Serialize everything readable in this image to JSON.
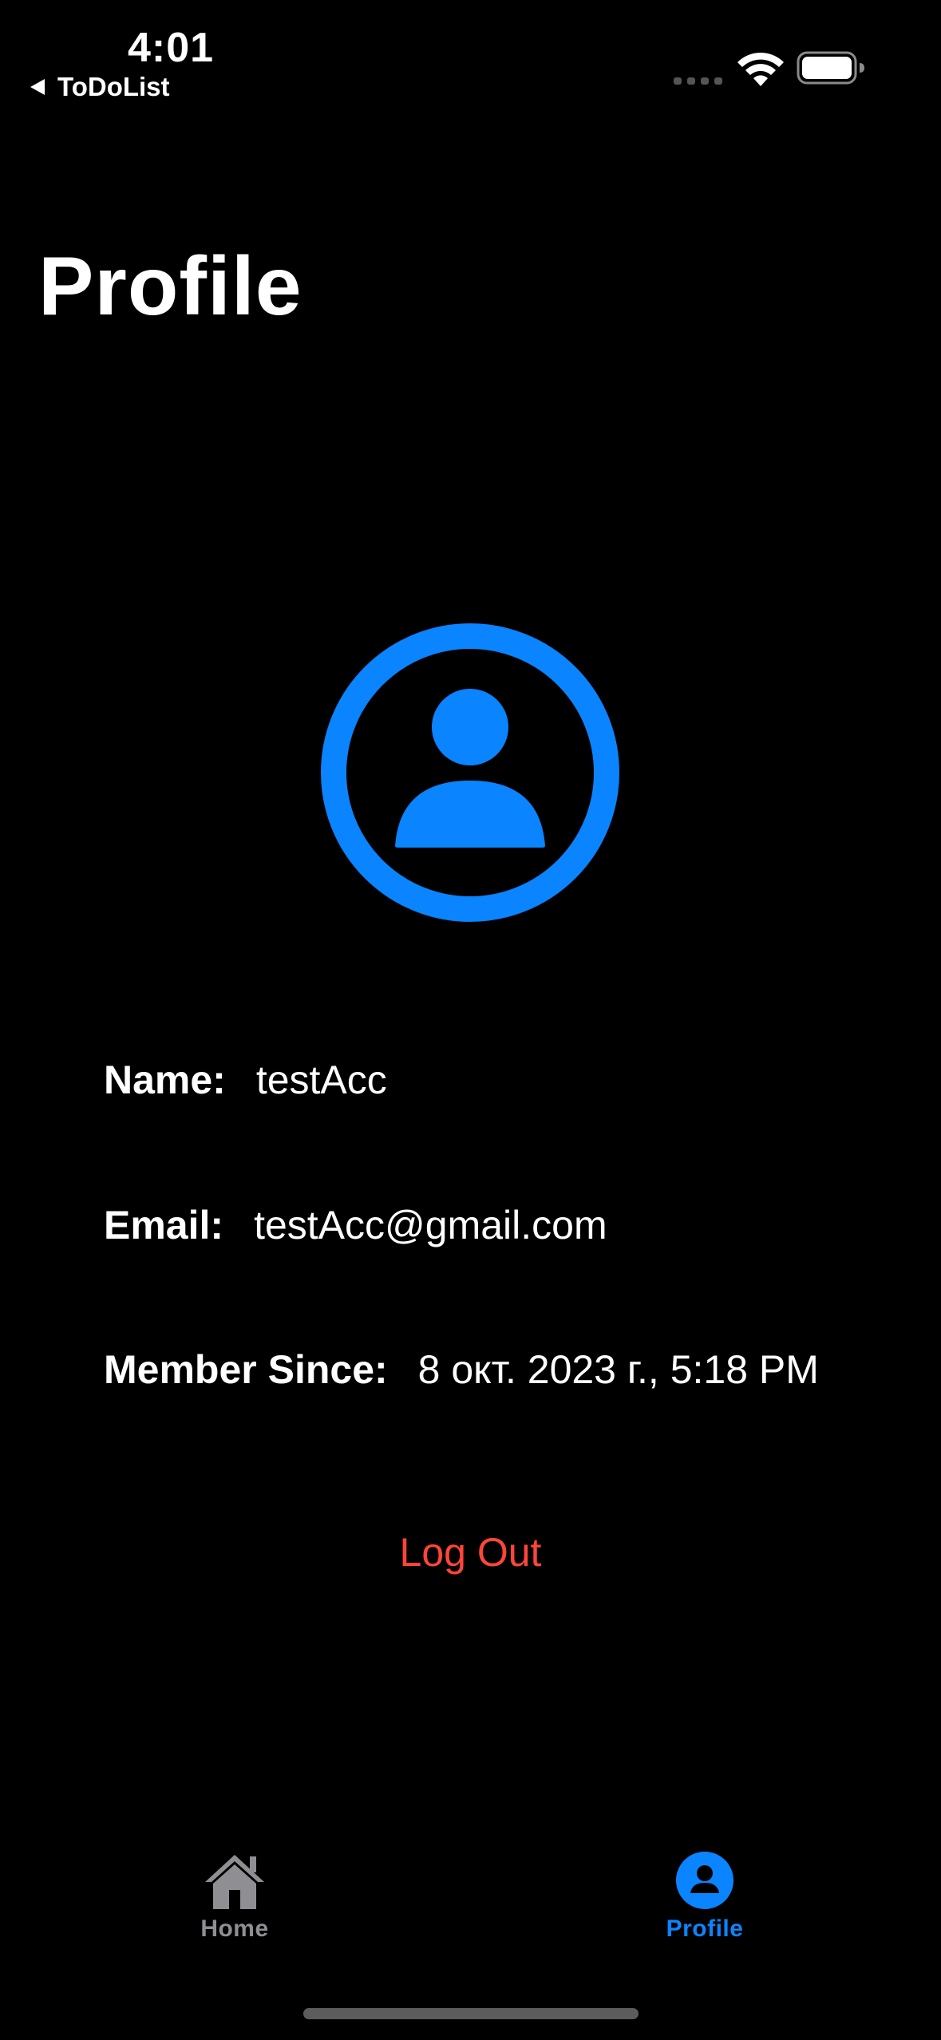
{
  "status_bar": {
    "time": "4:01",
    "back_app": "ToDoList",
    "icons": [
      "signal-dots-icon",
      "wifi-icon",
      "battery-icon"
    ]
  },
  "page": {
    "title": "Profile"
  },
  "avatar": {
    "icon": "person-circle-icon",
    "color": "#0a84ff"
  },
  "profile": {
    "name_label": "Name:",
    "name_value": "testAcc",
    "email_label": "Email:",
    "email_value": "testAcc@gmail.com",
    "since_label": "Member Since:",
    "since_value": "8 окт. 2023 г., 5:18 PM"
  },
  "actions": {
    "logout_label": "Log Out",
    "logout_color": "#ff453a"
  },
  "tab_bar": {
    "tabs": [
      {
        "label": "Home",
        "icon": "house-icon",
        "selected": false
      },
      {
        "label": "Profile",
        "icon": "person-circle-fill-icon",
        "selected": true
      }
    ],
    "selected_color": "#0a84ff",
    "unselected_color": "#8e8e93"
  }
}
